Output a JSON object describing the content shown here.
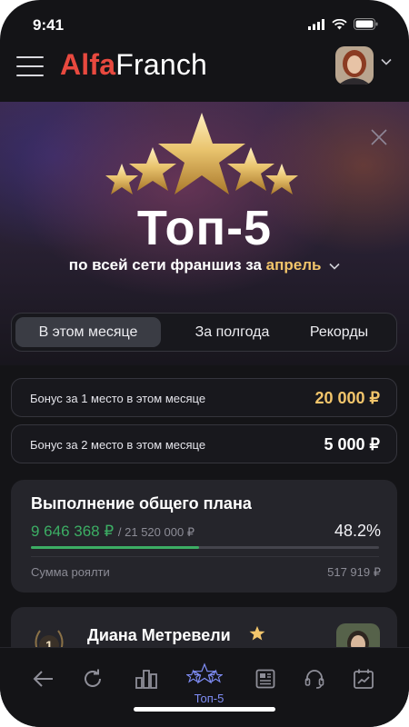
{
  "status_bar": {
    "time": "9:41"
  },
  "header": {
    "logo_part1": "Alfa",
    "logo_part2": "Franch"
  },
  "hero": {
    "title": "Топ-5",
    "subtitle_prefix": "по всей сети франшиз за ",
    "month": "апрель"
  },
  "tabs": [
    {
      "label": "В этом месяце",
      "active": true
    },
    {
      "label": "За полгода",
      "active": false
    },
    {
      "label": "Рекорды",
      "active": false
    }
  ],
  "bonuses": [
    {
      "label": "Бонус за 1 место в этом месяце",
      "value": "20 000 ₽",
      "color": "#f2c56b"
    },
    {
      "label": "Бонус за 2 место в этом месяце",
      "value": "5 000 ₽",
      "color": "#ffffff"
    }
  ],
  "plan": {
    "title": "Выполнение общего плана",
    "done": "9 646 368 ₽",
    "total": "/ 21 520 000 ₽",
    "percent_label": "48.2%",
    "progress": 0.482,
    "royalty_label": "Сумма роялти",
    "royalty_value": "517 919 ₽"
  },
  "leader": {
    "rank": "1",
    "name": "Диана Метревели"
  },
  "nav": {
    "active_label": "Топ-5",
    "items": [
      "back-icon",
      "refresh-icon",
      "chart-bars-icon",
      "stars-icon",
      "news-icon",
      "support-icon",
      "calendar-chart-icon"
    ]
  },
  "colors": {
    "accent_green": "#3cae64",
    "accent_gold": "#f2c56b",
    "accent_blue": "#7f8df6",
    "logo_red": "#e8493f"
  }
}
